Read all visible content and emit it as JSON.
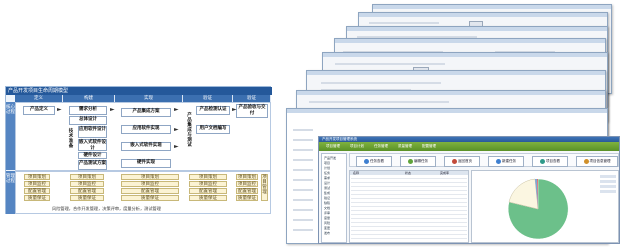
{
  "diagram": {
    "title": "产品开发项目生命周期模型",
    "phases": [
      "定义",
      "构建",
      "实现",
      "验证",
      "验证"
    ],
    "row_labels": [
      "核心过程",
      "管理过程"
    ],
    "boxes": {
      "product_definition": "产品定义",
      "requirement_analysis": "需求分析",
      "overall_design": "总体设计",
      "application_design": "应用软件设计",
      "embedded_design": "嵌入式软件设计",
      "hardware_design": "硬件设计",
      "test_plan": "产品测试方案",
      "tech_prep": "技术准备",
      "integration_plan": "产品集成方案",
      "app_impl": "应用软件实现",
      "embedded_impl": "嵌入式软件实现",
      "hardware_impl": "硬件实现",
      "integration_test": "产品集成与测试",
      "product_test_cert": "产品检测认证",
      "user_doc": "用户文档编写",
      "acceptance": "产品验收与交付"
    },
    "mgmt_items": [
      "项目策划",
      "项目监控",
      "配置管理",
      "质量保证"
    ],
    "mgmt_side": "项目管理",
    "footer": "风险管理，合作开发管理，决策评审，度量分析，测试管理"
  },
  "windows": {
    "front_title": "产品开发项目管理系统",
    "tabs": [
      "项目管理",
      "项目计划",
      "任务管理",
      "质量管理",
      "配置管理"
    ],
    "toolbar": [
      "任务查看",
      "编辑任务",
      "返回首页",
      "新建任务",
      "项目查看",
      "项目信息管理"
    ],
    "toolbar_colors": [
      "#3e7fd0",
      "#5fa33a",
      "#c24a3a",
      "#3e7fd0",
      "#2f9a8a",
      "#d0902a"
    ],
    "tree_items": [
      "产品开发",
      "项目",
      "计划",
      "任务",
      "需求",
      "设计",
      "测试",
      "集成",
      "验证",
      "缺陷",
      "文档",
      "评审",
      "度量",
      "风险",
      "变更",
      "发布"
    ],
    "list_header": [
      "名称",
      "状态",
      "完成率"
    ],
    "pie_colors": [
      "#6cc08a",
      "#fbf6e1",
      "#7ea6d8",
      "#e26b6b"
    ]
  }
}
